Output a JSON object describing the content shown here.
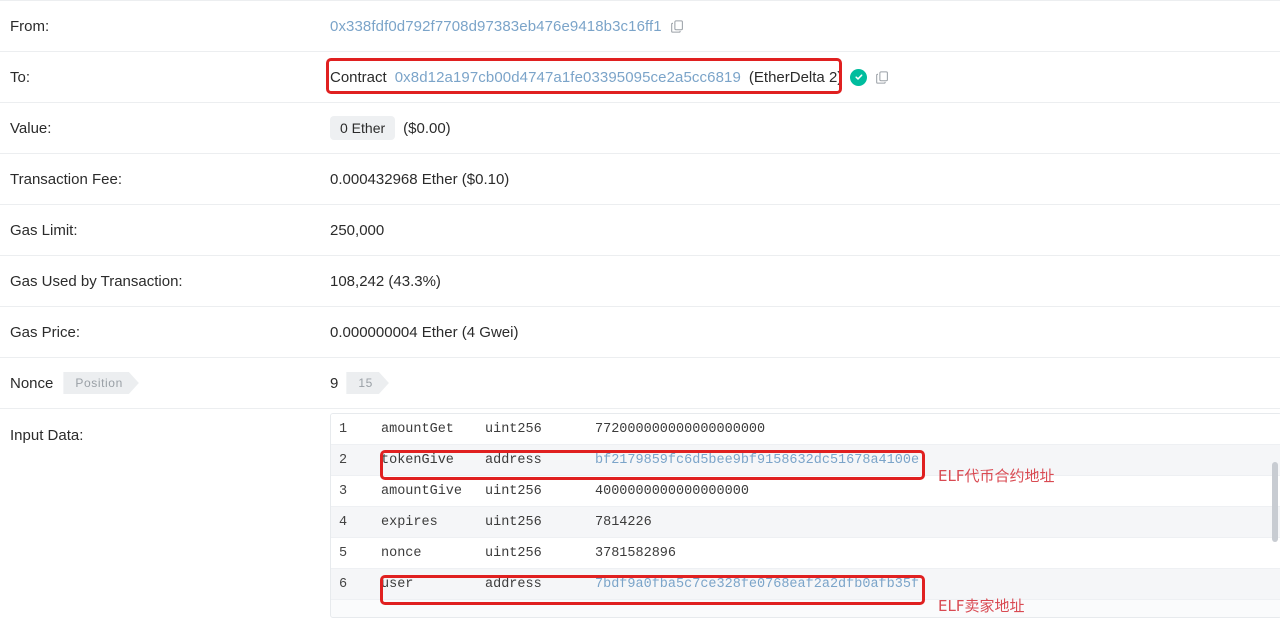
{
  "rows": {
    "from": {
      "label": "From:",
      "address": "0x338fdf0d792f7708d97383eb476e9418b3c16ff1",
      "copy_icon": "copy-icon"
    },
    "to": {
      "label": "To:",
      "prefix": "Contract",
      "address": "0x8d12a197cb00d4747a1fe03395095ce2a5cc6819",
      "tag": "(EtherDelta 2)",
      "verified_icon": "check-circle-icon",
      "copy_icon": "copy-icon"
    },
    "value": {
      "label": "Value:",
      "badge": "0 Ether",
      "fiat": "($0.00)"
    },
    "transaction_fee": {
      "label": "Transaction Fee:",
      "value": "0.000432968 Ether ($0.10)"
    },
    "gas_limit": {
      "label": "Gas Limit:",
      "value": "250,000"
    },
    "gas_used": {
      "label": "Gas Used by Transaction:",
      "value": "108,242 (43.3%)"
    },
    "gas_price": {
      "label": "Gas Price:",
      "value": "0.000000004 Ether (4 Gwei)"
    },
    "nonce": {
      "label": "Nonce",
      "position_tag": "Position",
      "value": "9",
      "value_tag": "15"
    },
    "input_data": {
      "label": "Input Data:"
    }
  },
  "input_data_lines": [
    {
      "num": "1",
      "name": "amountGet",
      "type": "uint256",
      "value": "772000000000000000000",
      "is_link": false
    },
    {
      "num": "2",
      "name": "tokenGive",
      "type": "address",
      "value": "bf2179859fc6d5bee9bf9158632dc51678a4100e",
      "is_link": true
    },
    {
      "num": "3",
      "name": "amountGive",
      "type": "uint256",
      "value": "4000000000000000000",
      "is_link": false
    },
    {
      "num": "4",
      "name": "expires",
      "type": "uint256",
      "value": "7814226",
      "is_link": false
    },
    {
      "num": "5",
      "name": "nonce",
      "type": "uint256",
      "value": "3781582896",
      "is_link": false
    },
    {
      "num": "6",
      "name": "user",
      "type": "address",
      "value": "7bdf9a0fba5c7ce328fe0768eaf2a2dfb0afb35f",
      "is_link": true
    }
  ],
  "annotations": {
    "token_contract": "ELF代币合约地址",
    "seller_address": "ELF卖家地址"
  },
  "colors": {
    "link": "#7ba4c9",
    "verified_green": "#00bd9e",
    "annotation_red": "#d94a52",
    "highlight_box": "#e02020"
  }
}
